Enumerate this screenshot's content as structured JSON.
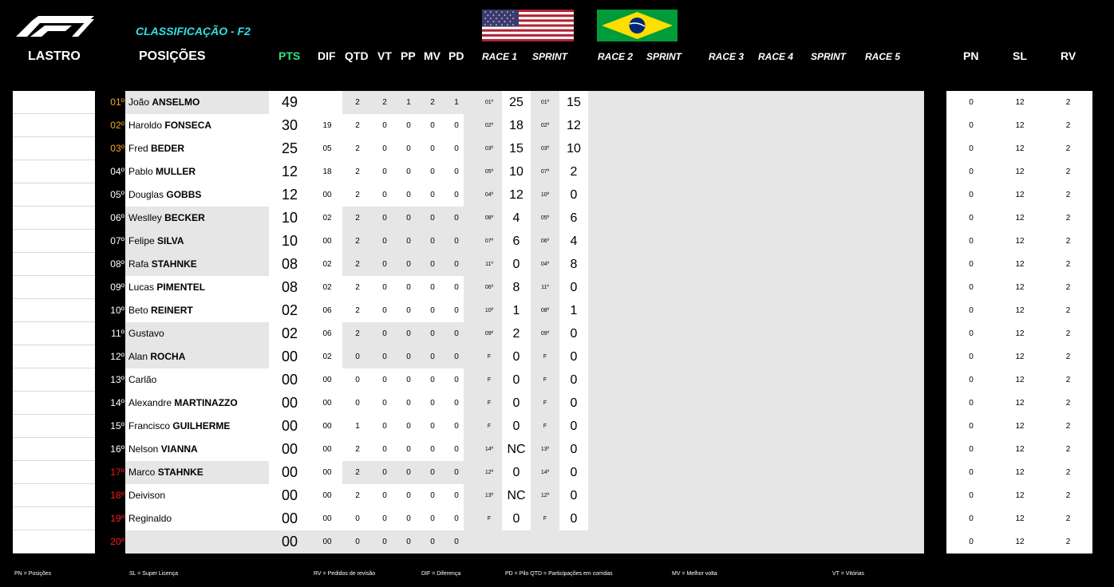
{
  "title": "CLASSIFICAÇÃO - F2",
  "logo": "f1-logo",
  "flags": [
    "usa-flag",
    "brazil-flag"
  ],
  "headers": {
    "lastro": "LASTRO",
    "posicoes": "POSIÇÕES",
    "pts": "PTS",
    "dif": "DIF",
    "qtd": "QTD",
    "vt": "VT",
    "pp": "PP",
    "mv": "MV",
    "pd": "PD",
    "race1": "RACE 1",
    "sprint1": "SPRINT",
    "race2": "RACE 2",
    "sprint2": "SPRINT",
    "race3": "RACE 3",
    "race4": "RACE 4",
    "sprint3": "SPRINT",
    "race5": "RACE 5",
    "pn": "PN",
    "sl": "SL",
    "rv": "RV"
  },
  "colors": {
    "title": "#2fe0e6",
    "pts_header": "#2ee67a",
    "top_positions": "#f0a820",
    "bottom_positions": "#ff1a1a"
  },
  "rows": [
    {
      "pos": "01º",
      "first": "João",
      "last": "ANSELMO",
      "pts": "49",
      "dif": "",
      "qtd": "2",
      "vt": "2",
      "pp": "1",
      "mv": "2",
      "pd": "1",
      "r1p": "01º",
      "r1": "25",
      "s1p": "01º",
      "s1": "15",
      "pn": "0",
      "sl": "12",
      "rv": "2"
    },
    {
      "pos": "02º",
      "first": "Haroldo",
      "last": "FONSECA",
      "pts": "30",
      "dif": "19",
      "qtd": "2",
      "vt": "0",
      "pp": "0",
      "mv": "0",
      "pd": "0",
      "r1p": "02º",
      "r1": "18",
      "s1p": "02º",
      "s1": "12",
      "pn": "0",
      "sl": "12",
      "rv": "2"
    },
    {
      "pos": "03º",
      "first": "Fred",
      "last": "BEDER",
      "pts": "25",
      "dif": "05",
      "qtd": "2",
      "vt": "0",
      "pp": "0",
      "mv": "0",
      "pd": "0",
      "r1p": "03º",
      "r1": "15",
      "s1p": "03º",
      "s1": "10",
      "pn": "0",
      "sl": "12",
      "rv": "2"
    },
    {
      "pos": "04º",
      "first": "Pablo",
      "last": "MULLER",
      "pts": "12",
      "dif": "18",
      "qtd": "2",
      "vt": "0",
      "pp": "0",
      "mv": "0",
      "pd": "0",
      "r1p": "05º",
      "r1": "10",
      "s1p": "07º",
      "s1": "2",
      "pn": "0",
      "sl": "12",
      "rv": "2"
    },
    {
      "pos": "05º",
      "first": "Douglas",
      "last": "GOBBS",
      "pts": "12",
      "dif": "00",
      "qtd": "2",
      "vt": "0",
      "pp": "0",
      "mv": "0",
      "pd": "0",
      "r1p": "04º",
      "r1": "12",
      "s1p": "10º",
      "s1": "0",
      "pn": "0",
      "sl": "12",
      "rv": "2"
    },
    {
      "pos": "06º",
      "first": "Weslley",
      "last": "BECKER",
      "pts": "10",
      "dif": "02",
      "qtd": "2",
      "vt": "0",
      "pp": "0",
      "mv": "0",
      "pd": "0",
      "r1p": "08º",
      "r1": "4",
      "s1p": "05º",
      "s1": "6",
      "pn": "0",
      "sl": "12",
      "rv": "2"
    },
    {
      "pos": "07º",
      "first": "Felipe",
      "last": "SILVA",
      "pts": "10",
      "dif": "00",
      "qtd": "2",
      "vt": "0",
      "pp": "0",
      "mv": "0",
      "pd": "0",
      "r1p": "07º",
      "r1": "6",
      "s1p": "06º",
      "s1": "4",
      "pn": "0",
      "sl": "12",
      "rv": "2"
    },
    {
      "pos": "08º",
      "first": "Rafa",
      "last": "STAHNKE",
      "pts": "08",
      "dif": "02",
      "qtd": "2",
      "vt": "0",
      "pp": "0",
      "mv": "0",
      "pd": "0",
      "r1p": "11º",
      "r1": "0",
      "s1p": "04º",
      "s1": "8",
      "pn": "0",
      "sl": "12",
      "rv": "2"
    },
    {
      "pos": "09º",
      "first": "Lucas",
      "last": "PIMENTEL",
      "pts": "08",
      "dif": "02",
      "qtd": "2",
      "vt": "0",
      "pp": "0",
      "mv": "0",
      "pd": "0",
      "r1p": "06º",
      "r1": "8",
      "s1p": "11º",
      "s1": "0",
      "pn": "0",
      "sl": "12",
      "rv": "2"
    },
    {
      "pos": "10º",
      "first": "Beto",
      "last": "REINERT",
      "pts": "02",
      "dif": "06",
      "qtd": "2",
      "vt": "0",
      "pp": "0",
      "mv": "0",
      "pd": "0",
      "r1p": "10º",
      "r1": "1",
      "s1p": "08º",
      "s1": "1",
      "pn": "0",
      "sl": "12",
      "rv": "2"
    },
    {
      "pos": "11º",
      "first": "Gustavo",
      "last": "",
      "pts": "02",
      "dif": "06",
      "qtd": "2",
      "vt": "0",
      "pp": "0",
      "mv": "0",
      "pd": "0",
      "r1p": "09º",
      "r1": "2",
      "s1p": "09º",
      "s1": "0",
      "pn": "0",
      "sl": "12",
      "rv": "2"
    },
    {
      "pos": "12º",
      "first": "Alan",
      "last": "ROCHA",
      "pts": "00",
      "dif": "02",
      "qtd": "0",
      "vt": "0",
      "pp": "0",
      "mv": "0",
      "pd": "0",
      "r1p": "F",
      "r1": "0",
      "s1p": "F",
      "s1": "0",
      "pn": "0",
      "sl": "12",
      "rv": "2"
    },
    {
      "pos": "13º",
      "first": "Carlão",
      "last": "",
      "pts": "00",
      "dif": "00",
      "qtd": "0",
      "vt": "0",
      "pp": "0",
      "mv": "0",
      "pd": "0",
      "r1p": "F",
      "r1": "0",
      "s1p": "F",
      "s1": "0",
      "pn": "0",
      "sl": "12",
      "rv": "2"
    },
    {
      "pos": "14º",
      "first": "Alexandre",
      "last": "MARTINAZZO",
      "pts": "00",
      "dif": "00",
      "qtd": "0",
      "vt": "0",
      "pp": "0",
      "mv": "0",
      "pd": "0",
      "r1p": "F",
      "r1": "0",
      "s1p": "F",
      "s1": "0",
      "pn": "0",
      "sl": "12",
      "rv": "2"
    },
    {
      "pos": "15º",
      "first": "Francisco",
      "last": "GUILHERME",
      "pts": "00",
      "dif": "00",
      "qtd": "1",
      "vt": "0",
      "pp": "0",
      "mv": "0",
      "pd": "0",
      "r1p": "F",
      "r1": "0",
      "s1p": "F",
      "s1": "0",
      "pn": "0",
      "sl": "12",
      "rv": "2"
    },
    {
      "pos": "16º",
      "first": "Nelson",
      "last": "VIANNA",
      "pts": "00",
      "dif": "00",
      "qtd": "2",
      "vt": "0",
      "pp": "0",
      "mv": "0",
      "pd": "0",
      "r1p": "14º",
      "r1": "NC",
      "s1p": "13º",
      "s1": "0",
      "pn": "0",
      "sl": "12",
      "rv": "2"
    },
    {
      "pos": "17º",
      "first": "Marco",
      "last": "STAHNKE",
      "pts": "00",
      "dif": "00",
      "qtd": "2",
      "vt": "0",
      "pp": "0",
      "mv": "0",
      "pd": "0",
      "r1p": "12º",
      "r1": "0",
      "s1p": "14º",
      "s1": "0",
      "pn": "0",
      "sl": "12",
      "rv": "2"
    },
    {
      "pos": "18º",
      "first": "Deivison",
      "last": "",
      "pts": "00",
      "dif": "00",
      "qtd": "2",
      "vt": "0",
      "pp": "0",
      "mv": "0",
      "pd": "0",
      "r1p": "13º",
      "r1": "NC",
      "s1p": "12º",
      "s1": "0",
      "pn": "0",
      "sl": "12",
      "rv": "2"
    },
    {
      "pos": "19º",
      "first": "Reginaldo",
      "last": "",
      "pts": "00",
      "dif": "00",
      "qtd": "0",
      "vt": "0",
      "pp": "0",
      "mv": "0",
      "pd": "0",
      "r1p": "F",
      "r1": "0",
      "s1p": "F",
      "s1": "0",
      "pn": "0",
      "sl": "12",
      "rv": "2"
    },
    {
      "pos": "20º",
      "first": "",
      "last": "",
      "pts": "00",
      "dif": "00",
      "qtd": "0",
      "vt": "0",
      "pp": "0",
      "mv": "0",
      "pd": "0",
      "r1p": "",
      "r1": "",
      "s1p": "",
      "s1": "",
      "pn": "0",
      "sl": "12",
      "rv": "2"
    }
  ],
  "footer": {
    "pn": "PN = Posições",
    "sl": "SL = Super Licença",
    "rv": "RV = Pedidos de revisão",
    "dif": "DIF = Diferença",
    "pd_qtd": "PD = Pilo QTD = Participações em corridas",
    "mv": "MV = Melhor volta",
    "vt": "VT = Vitórias"
  }
}
